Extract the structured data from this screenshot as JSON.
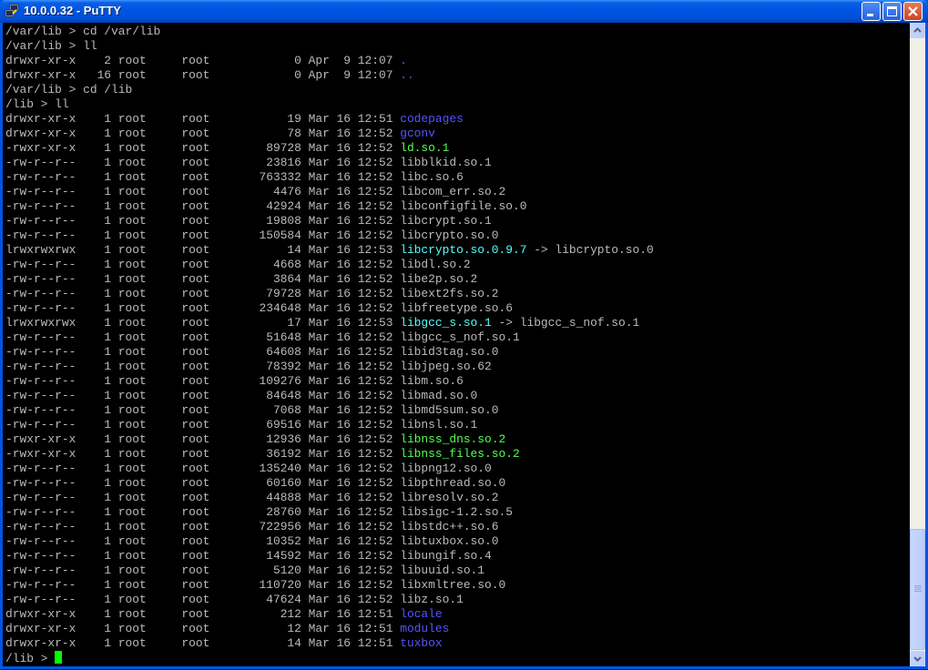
{
  "window": {
    "title": "10.0.0.32 - PuTTY"
  },
  "colors": {
    "dir": "#5555ff",
    "exe": "#55ff55",
    "link": "#55ffff",
    "text": "#bbbbbb",
    "cursor": "#00ff00"
  },
  "icons": {
    "app": "putty-icon",
    "minimize": "minimize-icon",
    "maximize": "maximize-icon",
    "close": "close-icon",
    "scroll_up": "arrow-up-icon",
    "scroll_down": "arrow-down-icon"
  },
  "terminal": {
    "lines": [
      {
        "text": "/var/lib > cd /var/lib"
      },
      {
        "text": "/var/lib > ll"
      },
      {
        "text": "drwxr-xr-x    2 root     root            0 Apr  9 12:07 ",
        "name": ".",
        "kind": "dir"
      },
      {
        "text": "drwxr-xr-x   16 root     root            0 Apr  9 12:07 ",
        "name": "..",
        "kind": "dir"
      },
      {
        "text": "/var/lib > cd /lib"
      },
      {
        "text": "/lib > ll"
      },
      {
        "text": "drwxr-xr-x    1 root     root           19 Mar 16 12:51 ",
        "name": "codepages",
        "kind": "dir"
      },
      {
        "text": "drwxr-xr-x    1 root     root           78 Mar 16 12:52 ",
        "name": "gconv",
        "kind": "dir"
      },
      {
        "text": "-rwxr-xr-x    1 root     root        89728 Mar 16 12:52 ",
        "name": "ld.so.1",
        "kind": "exe"
      },
      {
        "text": "-rw-r--r--    1 root     root        23816 Mar 16 12:52 ",
        "name": "libblkid.so.1"
      },
      {
        "text": "-rw-r--r--    1 root     root       763332 Mar 16 12:52 ",
        "name": "libc.so.6"
      },
      {
        "text": "-rw-r--r--    1 root     root         4476 Mar 16 12:52 ",
        "name": "libcom_err.so.2"
      },
      {
        "text": "-rw-r--r--    1 root     root        42924 Mar 16 12:52 ",
        "name": "libconfigfile.so.0"
      },
      {
        "text": "-rw-r--r--    1 root     root        19808 Mar 16 12:52 ",
        "name": "libcrypt.so.1"
      },
      {
        "text": "-rw-r--r--    1 root     root       150584 Mar 16 12:52 ",
        "name": "libcrypto.so.0"
      },
      {
        "text": "lrwxrwxrwx    1 root     root           14 Mar 16 12:53 ",
        "name": "libcrypto.so.0.9.7",
        "kind": "link",
        "target": " -> libcrypto.so.0"
      },
      {
        "text": "-rw-r--r--    1 root     root         4668 Mar 16 12:52 ",
        "name": "libdl.so.2"
      },
      {
        "text": "-rw-r--r--    1 root     root         3864 Mar 16 12:52 ",
        "name": "libe2p.so.2"
      },
      {
        "text": "-rw-r--r--    1 root     root        79728 Mar 16 12:52 ",
        "name": "libext2fs.so.2"
      },
      {
        "text": "-rw-r--r--    1 root     root       234648 Mar 16 12:52 ",
        "name": "libfreetype.so.6"
      },
      {
        "text": "lrwxrwxrwx    1 root     root           17 Mar 16 12:53 ",
        "name": "libgcc_s.so.1",
        "kind": "link",
        "target": " -> libgcc_s_nof.so.1"
      },
      {
        "text": "-rw-r--r--    1 root     root        51648 Mar 16 12:52 ",
        "name": "libgcc_s_nof.so.1"
      },
      {
        "text": "-rw-r--r--    1 root     root        64608 Mar 16 12:52 ",
        "name": "libid3tag.so.0"
      },
      {
        "text": "-rw-r--r--    1 root     root        78392 Mar 16 12:52 ",
        "name": "libjpeg.so.62"
      },
      {
        "text": "-rw-r--r--    1 root     root       109276 Mar 16 12:52 ",
        "name": "libm.so.6"
      },
      {
        "text": "-rw-r--r--    1 root     root        84648 Mar 16 12:52 ",
        "name": "libmad.so.0"
      },
      {
        "text": "-rw-r--r--    1 root     root         7068 Mar 16 12:52 ",
        "name": "libmd5sum.so.0"
      },
      {
        "text": "-rw-r--r--    1 root     root        69516 Mar 16 12:52 ",
        "name": "libnsl.so.1"
      },
      {
        "text": "-rwxr-xr-x    1 root     root        12936 Mar 16 12:52 ",
        "name": "libnss_dns.so.2",
        "kind": "exe"
      },
      {
        "text": "-rwxr-xr-x    1 root     root        36192 Mar 16 12:52 ",
        "name": "libnss_files.so.2",
        "kind": "exe"
      },
      {
        "text": "-rw-r--r--    1 root     root       135240 Mar 16 12:52 ",
        "name": "libpng12.so.0"
      },
      {
        "text": "-rw-r--r--    1 root     root        60160 Mar 16 12:52 ",
        "name": "libpthread.so.0"
      },
      {
        "text": "-rw-r--r--    1 root     root        44888 Mar 16 12:52 ",
        "name": "libresolv.so.2"
      },
      {
        "text": "-rw-r--r--    1 root     root        28760 Mar 16 12:52 ",
        "name": "libsigc-1.2.so.5"
      },
      {
        "text": "-rw-r--r--    1 root     root       722956 Mar 16 12:52 ",
        "name": "libstdc++.so.6"
      },
      {
        "text": "-rw-r--r--    1 root     root        10352 Mar 16 12:52 ",
        "name": "libtuxbox.so.0"
      },
      {
        "text": "-rw-r--r--    1 root     root        14592 Mar 16 12:52 ",
        "name": "libungif.so.4"
      },
      {
        "text": "-rw-r--r--    1 root     root         5120 Mar 16 12:52 ",
        "name": "libuuid.so.1"
      },
      {
        "text": "-rw-r--r--    1 root     root       110720 Mar 16 12:52 ",
        "name": "libxmltree.so.0"
      },
      {
        "text": "-rw-r--r--    1 root     root        47624 Mar 16 12:52 ",
        "name": "libz.so.1"
      },
      {
        "text": "drwxr-xr-x    1 root     root          212 Mar 16 12:51 ",
        "name": "locale",
        "kind": "dir"
      },
      {
        "text": "drwxr-xr-x    1 root     root           12 Mar 16 12:51 ",
        "name": "modules",
        "kind": "dir"
      },
      {
        "text": "drwxr-xr-x    1 root     root           14 Mar 16 12:51 ",
        "name": "tuxbox",
        "kind": "dir"
      }
    ],
    "prompt": "/lib > "
  }
}
